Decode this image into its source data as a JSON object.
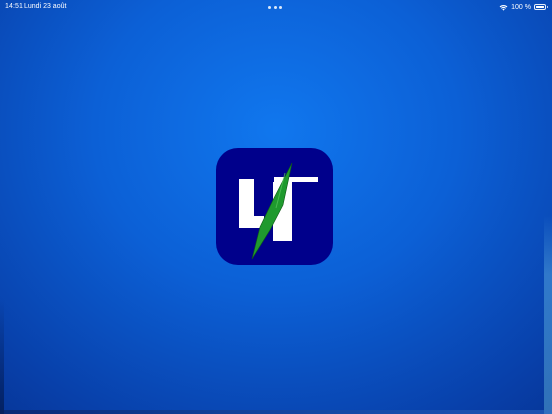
{
  "status_bar": {
    "time": "14:51",
    "date": "Lundi 23 août",
    "battery_percent_text": "100 %",
    "battery_level": 1.0,
    "icons": [
      "wifi-icon",
      "battery-icon",
      "multitasking-dots-icon"
    ]
  },
  "splash": {
    "logo_icon": "app-logo-icon",
    "colors": {
      "background_center": "#1077ee",
      "background_edge": "#052880",
      "logo_background": "#00008b",
      "logo_letters": "#ffffff",
      "logo_slash": "#1f9a2e"
    }
  }
}
